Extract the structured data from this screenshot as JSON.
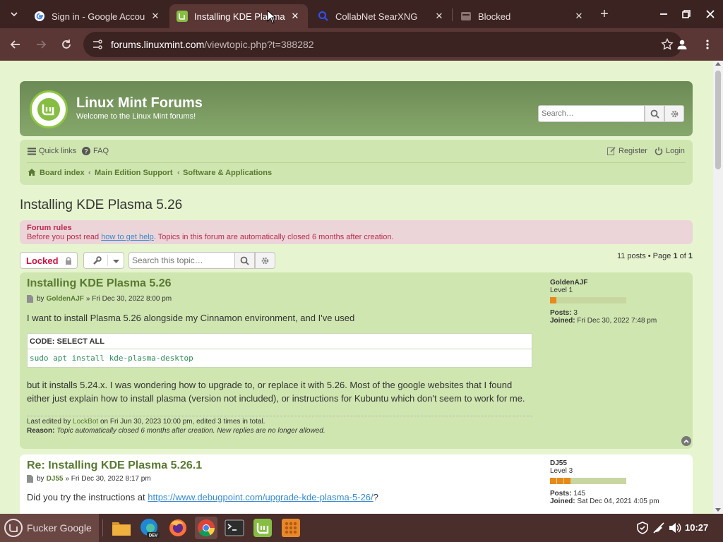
{
  "browser": {
    "tabs": [
      {
        "title": "Sign in - Google Accou",
        "favicon": "google-icon"
      },
      {
        "title": "Installing KDE Plasma",
        "favicon": "linux-mint-icon"
      },
      {
        "title": "CollabNet SearXNG",
        "favicon": "search-icon"
      },
      {
        "title": "Blocked",
        "favicon": "blocked-page-icon"
      }
    ],
    "url_host": "forums.linuxmint.com",
    "url_path": "/viewtopic.php?t=388282"
  },
  "site": {
    "title": "Linux Mint Forums",
    "description": "Welcome to the Linux Mint forums!",
    "search_placeholder": "Search…",
    "accent": "#5a7a32"
  },
  "navbar": {
    "quick_links": "Quick links",
    "faq": "FAQ",
    "register": "Register",
    "login": "Login",
    "breadcrumbs": [
      "Board index",
      "Main Edition Support",
      "Software & Applications"
    ]
  },
  "topic": {
    "title": "Installing KDE Plasma 5.26",
    "locked_label": "Locked",
    "search_placeholder": "Search this topic…",
    "pagination": {
      "prefix": "11 posts • Page",
      "current": "1",
      "of": "of",
      "total": "1"
    }
  },
  "rules": {
    "title": "Forum rules",
    "before": "Before you post read ",
    "link": "how to get help",
    "after": ". Topics in this forum are automatically closed 6 months after creation."
  },
  "posts": [
    {
      "title": "Installing KDE Plasma 5.26",
      "by": "by",
      "author": "GoldenAJF",
      "date": "» Fri Dec 30, 2022 8:00 pm",
      "body1": "I want to install Plasma 5.26 alongside my Cinnamon environment, and I've used",
      "code_header": "CODE: SELECT ALL",
      "code": "sudo apt install kde-plasma-desktop",
      "body2": "but it installs 5.24.x. I was wondering how to upgrade to, or replace it with 5.26. Most of the google websites that I found either just explain how to install plasma (version not included), or instructions for Kubuntu which don't seem to work for me.",
      "edit_prefix": "Last edited by ",
      "edit_user": "LockBot",
      "edit_suffix": " on Fri Jun 30, 2023 10:00 pm, edited 3 times in total.",
      "reason_label": "Reason:",
      "reason_text": "Topic automatically closed 6 months after creation. New replies are no longer allowed.",
      "profile": {
        "name": "GoldenAJF",
        "rank": "Level 1",
        "rank_level": 1,
        "posts_label": "Posts:",
        "posts": "3",
        "joined_label": "Joined:",
        "joined": "Fri Dec 30, 2022 7:48 pm"
      }
    },
    {
      "title": "Re: Installing KDE Plasma 5.26.1",
      "by": "by",
      "author": "DJ55",
      "date": "» Fri Dec 30, 2022 8:17 pm",
      "body_prefix": "Did you try the instructions at ",
      "body_link": "https://www.debugpoint.com/upgrade-kde-plasma-5-26/",
      "body_suffix": "?",
      "profile": {
        "name": "DJ55",
        "rank": "Level 3",
        "rank_level": 3,
        "posts_label": "Posts:",
        "posts": "145",
        "joined_label": "Joined:",
        "joined": "Sat Dec 04, 2021 4:05 pm"
      }
    }
  ],
  "taskbar": {
    "menu_label": "Fucker Google",
    "apps": [
      "files-icon",
      "edge-dev-icon",
      "firefox-icon",
      "chrome-icon",
      "terminal-icon",
      "mint-update-icon",
      "app-grid-icon"
    ],
    "clock": "10:27"
  }
}
